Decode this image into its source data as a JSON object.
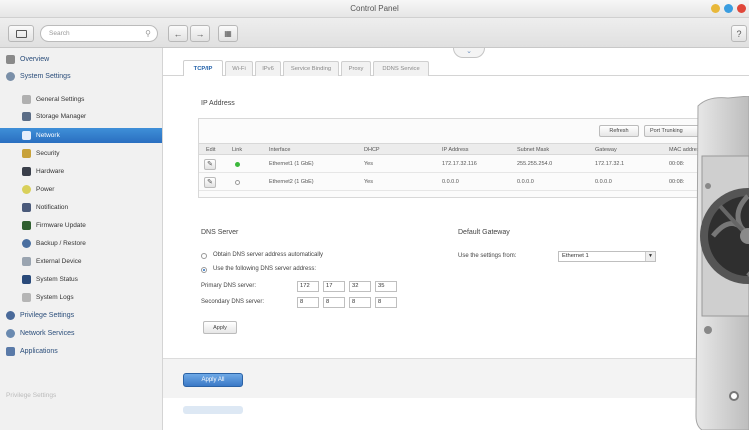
{
  "window": {
    "title": "Control Panel"
  },
  "toolbar": {
    "search_placeholder": "Search",
    "search_icon": "magnifier-icon",
    "back_icon": "arrow-left-icon",
    "forward_icon": "arrow-right-icon",
    "grid_icon": "grid-icon",
    "help_label": "?"
  },
  "sidebar": {
    "items": [
      {
        "label": "Overview",
        "level": 0
      },
      {
        "label": "System Settings",
        "level": 0
      },
      {
        "label": "General Settings",
        "level": 1
      },
      {
        "label": "Storage Manager",
        "level": 1
      },
      {
        "label": "Network",
        "level": 1,
        "active": true
      },
      {
        "label": "Security",
        "level": 1
      },
      {
        "label": "Hardware",
        "level": 1
      },
      {
        "label": "Power",
        "level": 1
      },
      {
        "label": "Notification",
        "level": 1
      },
      {
        "label": "Firmware Update",
        "level": 1
      },
      {
        "label": "Backup / Restore",
        "level": 1
      },
      {
        "label": "External Device",
        "level": 1
      },
      {
        "label": "System Status",
        "level": 1
      },
      {
        "label": "System Logs",
        "level": 1
      },
      {
        "label": "Privilege Settings",
        "level": 0
      },
      {
        "label": "Network Services",
        "level": 0
      },
      {
        "label": "Applications",
        "level": 0
      }
    ],
    "faded_bottom": "Privilege Settings"
  },
  "tabs": [
    "TCP/IP",
    "Wi-Fi",
    "IPv6",
    "Service Binding",
    "Proxy",
    "DDNS Service"
  ],
  "ip_address": {
    "title": "IP Address",
    "refresh_label": "Refresh",
    "port_label": "Port Trunking",
    "columns": [
      "Edit",
      "Link",
      "Interface",
      "DHCP",
      "IP Address",
      "Subnet Mask",
      "Gateway",
      "MAC address"
    ],
    "rows": [
      {
        "link": "up",
        "interface": "Ethernet1 (1 GbE)",
        "dhcp": "Yes",
        "ip": "172.17.32.116",
        "mask": "255.255.254.0",
        "gateway": "172.17.32.1",
        "mac": "00:08:"
      },
      {
        "link": "down",
        "interface": "Ethernet2 (1 GbE)",
        "dhcp": "Yes",
        "ip": "0.0.0.0",
        "mask": "0.0.0.0",
        "gateway": "0.0.0.0",
        "mac": "00:08:"
      }
    ]
  },
  "dns": {
    "title": "DNS Server",
    "option_auto": "Obtain DNS server address automatically",
    "option_manual": "Use the following DNS server address:",
    "primary_label": "Primary DNS server:",
    "secondary_label": "Secondary DNS server:",
    "primary": [
      "172",
      "17",
      "32",
      "35"
    ],
    "secondary": [
      "8",
      "8",
      "8",
      "8"
    ],
    "apply_label": "Apply"
  },
  "gateway": {
    "title": "Default Gateway",
    "use_label": "Use the settings from:",
    "selected": "Ethernet 1"
  },
  "footer": {
    "apply_all_label": "Apply All"
  },
  "colors": {
    "accent": "#2a6fc0",
    "link_up": "#3cb83c",
    "link_down": "#9a9a9a"
  }
}
